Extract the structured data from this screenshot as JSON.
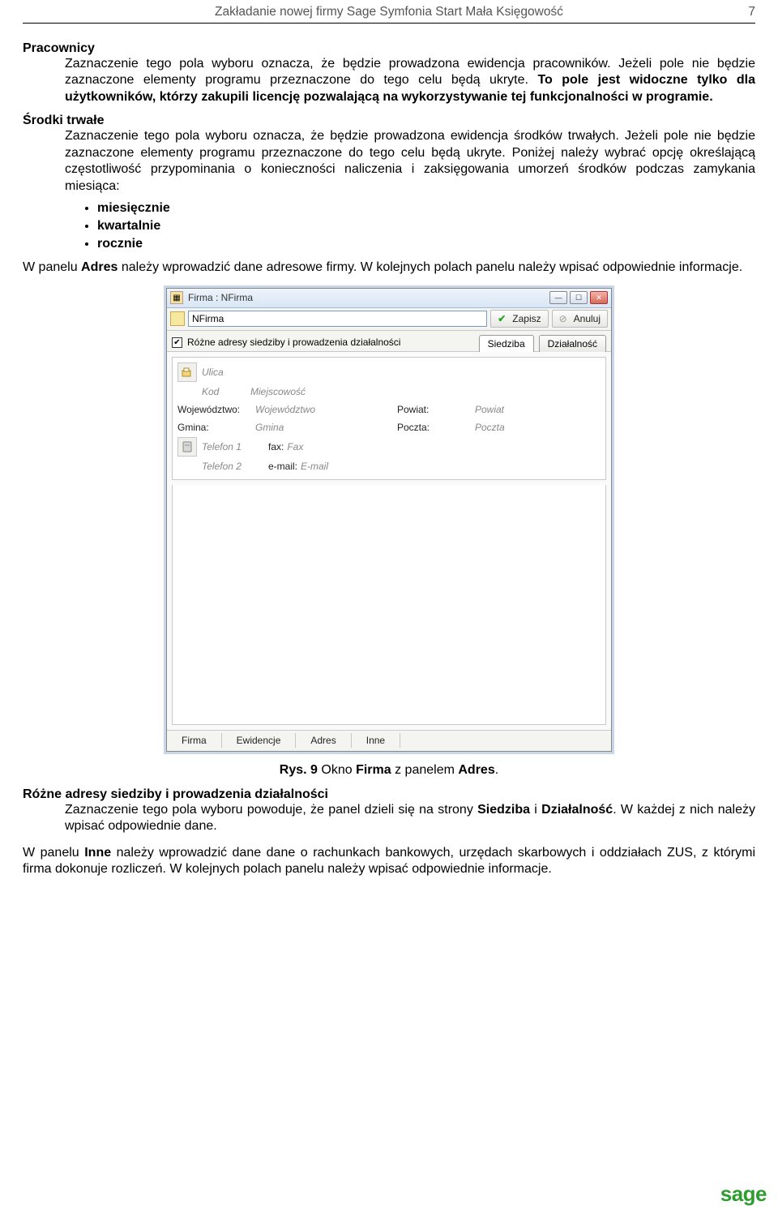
{
  "header": {
    "title": "Zakładanie nowej firmy Sage Symfonia Start Mała Księgowość",
    "page": "7"
  },
  "h_pracownicy": "Pracownicy",
  "p_pracownicy_a": "Zaznaczenie tego pola wyboru oznacza, że będzie prowadzona ewidencja pracowników. Jeżeli pole nie będzie zaznaczone elementy programu przeznaczone do tego celu będą ukryte. ",
  "p_pracownicy_b": "To pole jest widoczne tylko dla użytkowników, którzy zakupili licencję pozwalającą na wykorzystywanie tej funkcjonalności w programie.",
  "h_srodki": "Środki trwałe",
  "p_srodki": "Zaznaczenie tego pola wyboru oznacza, że będzie prowadzona ewidencja środków trwałych. Jeżeli pole nie będzie zaznaczone elementy programu przeznaczone do tego celu będą ukryte. Poniżej należy wybrać opcję określającą częstotliwość przypominania o konieczności naliczenia i zaksięgowania umorzeń środków podczas zamykania miesiąca:",
  "bullets": [
    "miesięcznie",
    "kwartalnie",
    "rocznie"
  ],
  "p_adres_a": "W panelu ",
  "p_adres_b": "Adres",
  "p_adres_c": " należy wprowadzić dane adresowe firmy. W kolejnych polach panelu należy wpisać odpowiednie informacje.",
  "caption_a": "Rys. 9",
  "caption_b": " Okno ",
  "caption_c": "Firma",
  "caption_d": " z panelem ",
  "caption_e": "Adres",
  "caption_f": ".",
  "h_rozne": "Różne adresy siedziby i prowadzenia działalności",
  "p_rozne_a": "Zaznaczenie tego pola wyboru powoduje, że panel dzieli się na strony ",
  "p_rozne_b": "Siedziba",
  "p_rozne_c": " i ",
  "p_rozne_d": "Działalność",
  "p_rozne_e": ". W każdej z nich należy wpisać odpowiednie dane.",
  "p_inne_a": "W panelu ",
  "p_inne_b": "Inne",
  "p_inne_c": " należy wprowadzić dane dane o rachunkach bankowych, urzędach skarbowych i oddziałach ZUS, z którymi firma dokonuje rozliczeń. W kolejnych polach panelu należy wpisać odpowiednie informacje.",
  "logo": "sage",
  "window": {
    "title": "Firma : NFirma",
    "name_value": "NFirma",
    "save": "Zapisz",
    "cancel": "Anuluj",
    "checkbox_label": "Różne adresy siedziby i prowadzenia działalności",
    "tab_siedziba": "Siedziba",
    "tab_dzialalnosc": "Działalność",
    "ulica": "Ulica",
    "kod": "Kod",
    "miejscowosc": "Miejscowość",
    "wojewodztwo_lbl": "Województwo:",
    "wojewodztwo": "Województwo",
    "powiat_lbl": "Powiat:",
    "powiat": "Powiat",
    "gmina_lbl": "Gmina:",
    "gmina": "Gmina",
    "poczta_lbl": "Poczta:",
    "poczta": "Poczta",
    "telefon1": "Telefon 1",
    "fax_lbl": "fax:",
    "fax": "Fax",
    "telefon2": "Telefon 2",
    "email_lbl": "e-mail:",
    "email": "E-mail",
    "btab_firma": "Firma",
    "btab_ewidencje": "Ewidencje",
    "btab_adres": "Adres",
    "btab_inne": "Inne"
  }
}
